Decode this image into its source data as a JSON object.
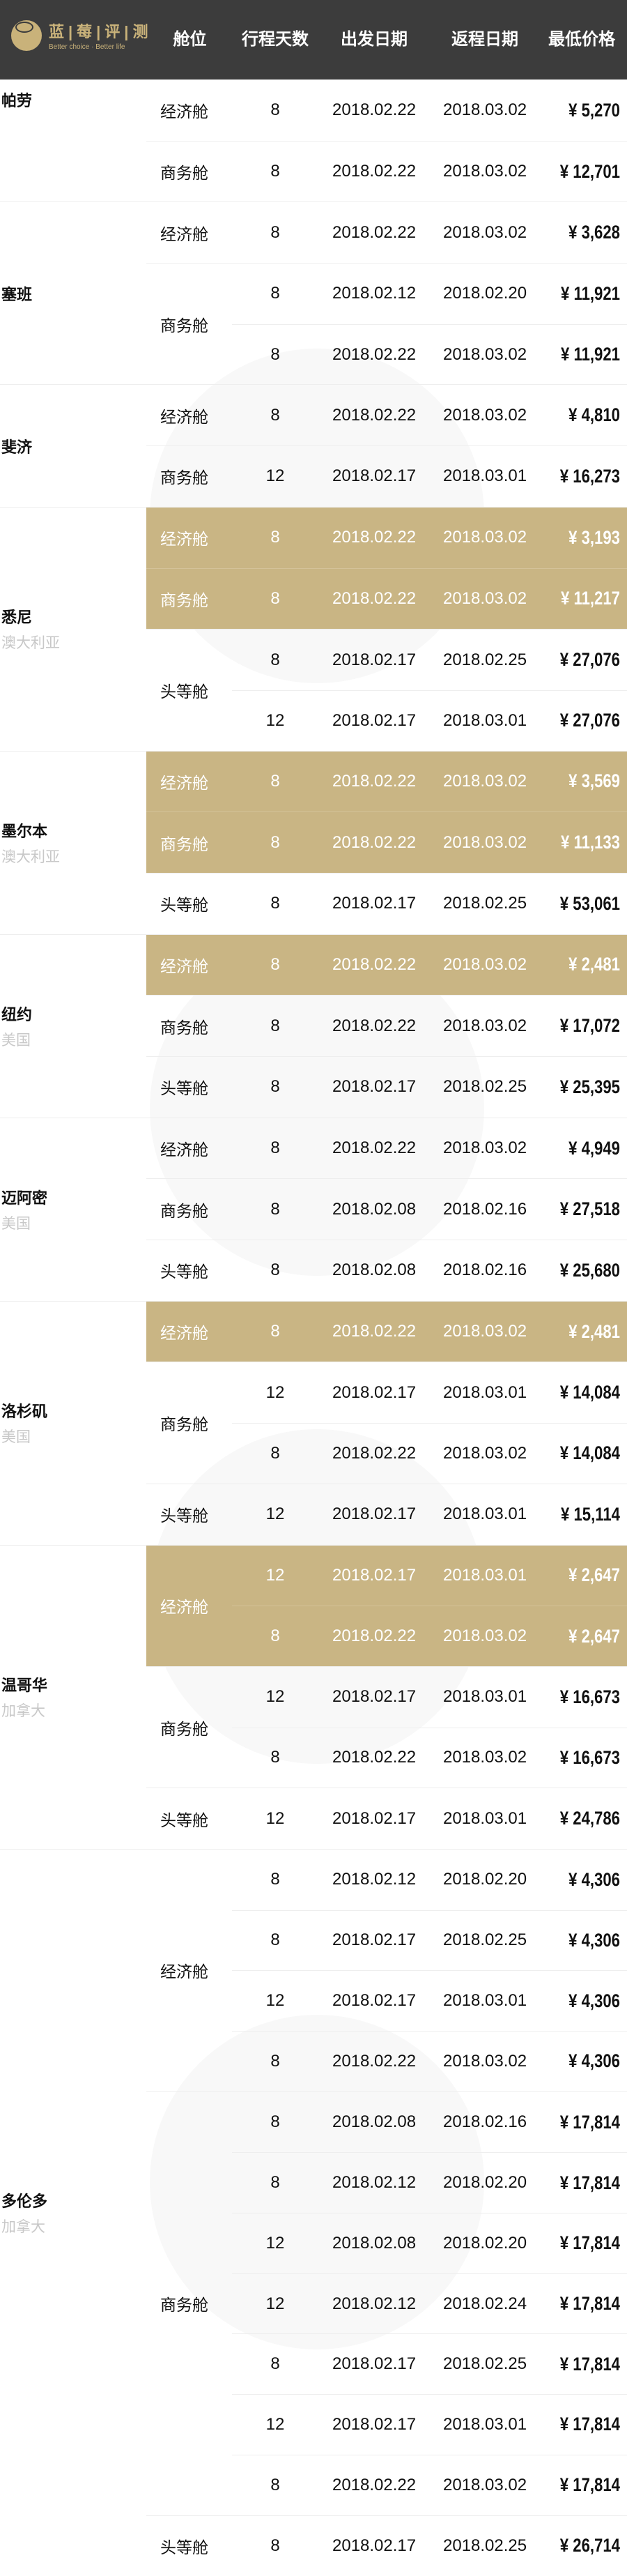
{
  "header": {
    "logo_cn": "蓝|莓|评|测",
    "logo_en": "Better choice · Better life",
    "columns": [
      "舱位",
      "行程天数",
      "出发日期",
      "返程日期",
      "最低价格"
    ]
  },
  "colors": {
    "header_bg": "#3c3c3c",
    "highlight": "#c9b584",
    "brand_gold": "#c9b27a"
  },
  "groups": [
    {
      "city": "帕劳",
      "country": "",
      "cabins": [
        {
          "cabin": "经济舱",
          "rows": [
            {
              "days": "8",
              "dep": "2018.02.22",
              "ret": "2018.03.02",
              "price": "¥ 5,270"
            }
          ]
        },
        {
          "cabin": "商务舱",
          "rows": [
            {
              "days": "8",
              "dep": "2018.02.22",
              "ret": "2018.03.02",
              "price": "¥ 12,701"
            }
          ]
        }
      ]
    },
    {
      "city": "塞班",
      "country": "",
      "cabins": [
        {
          "cabin": "经济舱",
          "rows": [
            {
              "days": "8",
              "dep": "2018.02.22",
              "ret": "2018.03.02",
              "price": "¥ 3,628"
            }
          ]
        },
        {
          "cabin": "商务舱",
          "rows": [
            {
              "days": "8",
              "dep": "2018.02.12",
              "ret": "2018.02.20",
              "price": "¥ 11,921"
            },
            {
              "days": "8",
              "dep": "2018.02.22",
              "ret": "2018.03.02",
              "price": "¥ 11,921"
            }
          ]
        }
      ]
    },
    {
      "city": "斐济",
      "country": "",
      "cabins": [
        {
          "cabin": "经济舱",
          "rows": [
            {
              "days": "8",
              "dep": "2018.02.22",
              "ret": "2018.03.02",
              "price": "¥ 4,810"
            }
          ]
        },
        {
          "cabin": "商务舱",
          "rows": [
            {
              "days": "12",
              "dep": "2018.02.17",
              "ret": "2018.03.01",
              "price": "¥ 16,273"
            }
          ]
        }
      ]
    },
    {
      "city": "悉尼",
      "country": "澳大利亚",
      "cabins": [
        {
          "cabin": "经济舱",
          "highlight": true,
          "rows": [
            {
              "days": "8",
              "dep": "2018.02.22",
              "ret": "2018.03.02",
              "price": "¥ 3,193"
            }
          ]
        },
        {
          "cabin": "商务舱",
          "highlight": true,
          "rows": [
            {
              "days": "8",
              "dep": "2018.02.22",
              "ret": "2018.03.02",
              "price": "¥ 11,217"
            }
          ]
        },
        {
          "cabin": "头等舱",
          "rows": [
            {
              "days": "8",
              "dep": "2018.02.17",
              "ret": "2018.02.25",
              "price": "¥ 27,076"
            },
            {
              "days": "12",
              "dep": "2018.02.17",
              "ret": "2018.03.01",
              "price": "¥ 27,076"
            }
          ]
        }
      ]
    },
    {
      "city": "墨尔本",
      "country": "澳大利亚",
      "cabins": [
        {
          "cabin": "经济舱",
          "highlight": true,
          "rows": [
            {
              "days": "8",
              "dep": "2018.02.22",
              "ret": "2018.03.02",
              "price": "¥ 3,569"
            }
          ]
        },
        {
          "cabin": "商务舱",
          "highlight": true,
          "rows": [
            {
              "days": "8",
              "dep": "2018.02.22",
              "ret": "2018.03.02",
              "price": "¥ 11,133"
            }
          ]
        },
        {
          "cabin": "头等舱",
          "rows": [
            {
              "days": "8",
              "dep": "2018.02.17",
              "ret": "2018.02.25",
              "price": "¥ 53,061"
            }
          ]
        }
      ]
    },
    {
      "city": "纽约",
      "country": "美国",
      "cabins": [
        {
          "cabin": "经济舱",
          "highlight": true,
          "rows": [
            {
              "days": "8",
              "dep": "2018.02.22",
              "ret": "2018.03.02",
              "price": "¥ 2,481"
            }
          ]
        },
        {
          "cabin": "商务舱",
          "rows": [
            {
              "days": "8",
              "dep": "2018.02.22",
              "ret": "2018.03.02",
              "price": "¥ 17,072"
            }
          ]
        },
        {
          "cabin": "头等舱",
          "rows": [
            {
              "days": "8",
              "dep": "2018.02.17",
              "ret": "2018.02.25",
              "price": "¥ 25,395"
            }
          ]
        }
      ]
    },
    {
      "city": "迈阿密",
      "country": "美国",
      "cabins": [
        {
          "cabin": "经济舱",
          "rows": [
            {
              "days": "8",
              "dep": "2018.02.22",
              "ret": "2018.03.02",
              "price": "¥ 4,949"
            }
          ]
        },
        {
          "cabin": "商务舱",
          "rows": [
            {
              "days": "8",
              "dep": "2018.02.08",
              "ret": "2018.02.16",
              "price": "¥ 27,518"
            }
          ]
        },
        {
          "cabin": "头等舱",
          "rows": [
            {
              "days": "8",
              "dep": "2018.02.08",
              "ret": "2018.02.16",
              "price": "¥ 25,680"
            }
          ]
        }
      ]
    },
    {
      "city": "洛杉矶",
      "country": "美国",
      "cabins": [
        {
          "cabin": "经济舱",
          "highlight": true,
          "rows": [
            {
              "days": "8",
              "dep": "2018.02.22",
              "ret": "2018.03.02",
              "price": "¥ 2,481"
            }
          ]
        },
        {
          "cabin": "商务舱",
          "rows": [
            {
              "days": "12",
              "dep": "2018.02.17",
              "ret": "2018.03.01",
              "price": "¥ 14,084"
            },
            {
              "days": "8",
              "dep": "2018.02.22",
              "ret": "2018.03.02",
              "price": "¥ 14,084"
            }
          ]
        },
        {
          "cabin": "头等舱",
          "rows": [
            {
              "days": "12",
              "dep": "2018.02.17",
              "ret": "2018.03.01",
              "price": "¥ 15,114"
            }
          ]
        }
      ]
    },
    {
      "city": "温哥华",
      "country": "加拿大",
      "cabins": [
        {
          "cabin": "经济舱",
          "highlight": true,
          "rows": [
            {
              "days": "12",
              "dep": "2018.02.17",
              "ret": "2018.03.01",
              "price": "¥ 2,647"
            },
            {
              "days": "8",
              "dep": "2018.02.22",
              "ret": "2018.03.02",
              "price": "¥ 2,647"
            }
          ]
        },
        {
          "cabin": "商务舱",
          "rows": [
            {
              "days": "12",
              "dep": "2018.02.17",
              "ret": "2018.03.01",
              "price": "¥ 16,673"
            },
            {
              "days": "8",
              "dep": "2018.02.22",
              "ret": "2018.03.02",
              "price": "¥ 16,673"
            }
          ]
        },
        {
          "cabin": "头等舱",
          "rows": [
            {
              "days": "12",
              "dep": "2018.02.17",
              "ret": "2018.03.01",
              "price": "¥ 24,786"
            }
          ]
        }
      ]
    },
    {
      "city": "多伦多",
      "country": "加拿大",
      "cabins": [
        {
          "cabin": "经济舱",
          "rows": [
            {
              "days": "8",
              "dep": "2018.02.12",
              "ret": "2018.02.20",
              "price": "¥ 4,306"
            },
            {
              "days": "8",
              "dep": "2018.02.17",
              "ret": "2018.02.25",
              "price": "¥ 4,306"
            },
            {
              "days": "12",
              "dep": "2018.02.17",
              "ret": "2018.03.01",
              "price": "¥ 4,306"
            },
            {
              "days": "8",
              "dep": "2018.02.22",
              "ret": "2018.03.02",
              "price": "¥ 4,306"
            }
          ]
        },
        {
          "cabin": "商务舱",
          "rows": [
            {
              "days": "8",
              "dep": "2018.02.08",
              "ret": "2018.02.16",
              "price": "¥ 17,814"
            },
            {
              "days": "8",
              "dep": "2018.02.12",
              "ret": "2018.02.20",
              "price": "¥ 17,814"
            },
            {
              "days": "12",
              "dep": "2018.02.08",
              "ret": "2018.02.20",
              "price": "¥ 17,814"
            },
            {
              "days": "12",
              "dep": "2018.02.12",
              "ret": "2018.02.24",
              "price": "¥ 17,814"
            },
            {
              "days": "8",
              "dep": "2018.02.17",
              "ret": "2018.02.25",
              "price": "¥ 17,814"
            },
            {
              "days": "12",
              "dep": "2018.02.17",
              "ret": "2018.03.01",
              "price": "¥ 17,814"
            },
            {
              "days": "8",
              "dep": "2018.02.22",
              "ret": "2018.03.02",
              "price": "¥ 17,814"
            }
          ]
        },
        {
          "cabin": "头等舱",
          "rows": [
            {
              "days": "8",
              "dep": "2018.02.17",
              "ret": "2018.02.25",
              "price": "¥ 26,714"
            }
          ]
        }
      ]
    }
  ]
}
